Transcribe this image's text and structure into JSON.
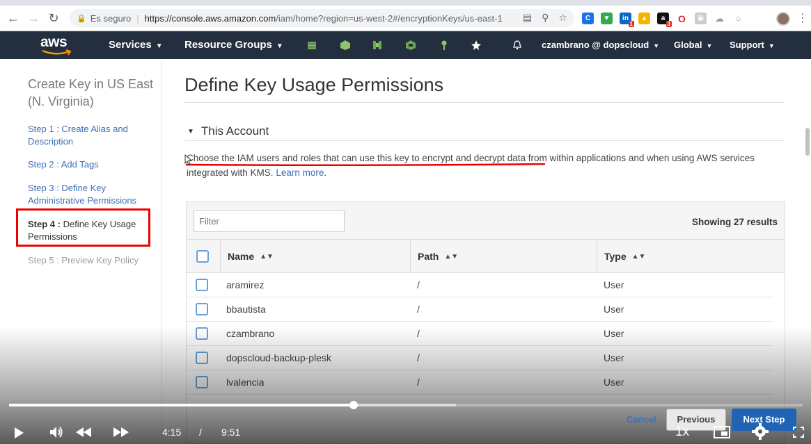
{
  "browser": {
    "secure_label": "Es seguro",
    "url_main": "https://console.aws.amazon.com",
    "url_rest": "/iam/home?region=us-west-2#/encryptionKeys/us-east-1",
    "ext_badges": [
      "1",
      "3"
    ]
  },
  "aws_nav": {
    "logo": "aws",
    "services": "Services",
    "resource_groups": "Resource Groups",
    "account": "czambrano @ dopscloud",
    "region": "Global",
    "support": "Support"
  },
  "wizard": {
    "title": "Create Key in US East (N. Virginia)",
    "steps": [
      {
        "prefix": "Step 1 : ",
        "label": "Create Alias and Description"
      },
      {
        "prefix": "Step 2 : ",
        "label": "Add Tags"
      },
      {
        "prefix": "Step 3 : ",
        "label": "Define Key Administrative Permissions"
      },
      {
        "prefix": "Step 4 : ",
        "label": "Define Key Usage Permissions"
      },
      {
        "prefix": "Step 5 : ",
        "label": "Preview Key Policy"
      }
    ]
  },
  "main": {
    "page_title": "Define Key Usage Permissions",
    "section_title": "This Account",
    "description": "Choose the IAM users and roles that can use this key to encrypt and decrypt data from within applications and when using AWS services integrated with KMS.",
    "learn_more": "Learn more",
    "filter_placeholder": "Filter",
    "showing": "Showing 27 results",
    "columns": [
      "Name",
      "Path",
      "Type"
    ],
    "rows": [
      {
        "name": "aramirez",
        "path": "/",
        "type": "User"
      },
      {
        "name": "bbautista",
        "path": "/",
        "type": "User"
      },
      {
        "name": "czambrano",
        "path": "/",
        "type": "User"
      },
      {
        "name": "dopscloud-backup-plesk",
        "path": "/",
        "type": "User"
      },
      {
        "name": "lvalencia",
        "path": "/",
        "type": "User"
      }
    ],
    "cancel": "Cancel",
    "previous": "Previous",
    "next": "Next Step"
  },
  "video": {
    "current_time": "4:15",
    "separator": "/",
    "duration": "9:51",
    "speed": "1x",
    "progress_fraction": 0.434,
    "buffered_fraction": 0.563
  },
  "colors": {
    "aws_nav_bg": "#232f3e",
    "link": "#3b6fb6",
    "highlight_red": "#e00",
    "next_button": "#1f63b5"
  }
}
